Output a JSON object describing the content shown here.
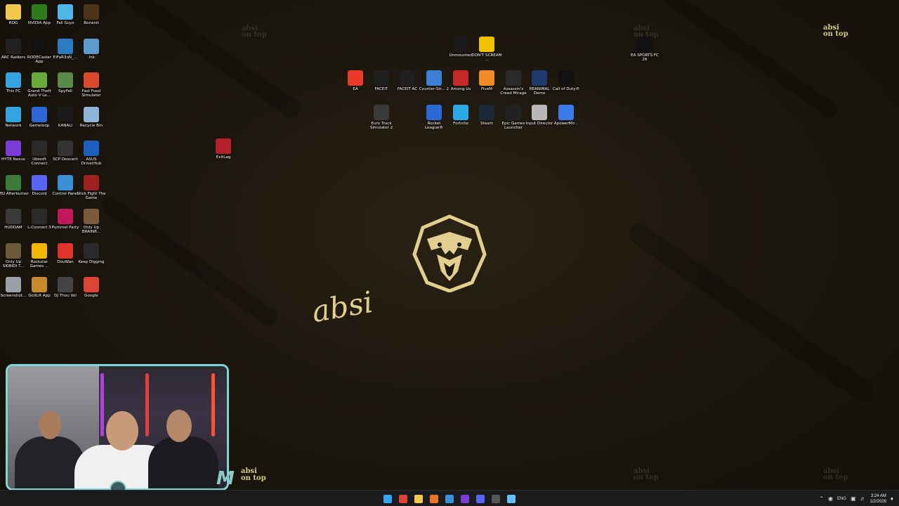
{
  "desktop": {
    "watermark_top": [
      "absi",
      "on top"
    ],
    "watermark_bottom": [
      "absi",
      "on top"
    ],
    "script_name": "absi",
    "icons_left": [
      {
        "label": "ROG",
        "icon": "folder-icon",
        "color": "#f2c94c"
      },
      {
        "label": "NVIDIA App",
        "icon": "nvidia-icon",
        "color": "#2f7a1a"
      },
      {
        "label": "Fall Guys",
        "icon": "fall-guys-icon",
        "color": "#4fb6e8"
      },
      {
        "label": "Bonanit",
        "icon": "bonanit-icon",
        "color": "#4a3318"
      },
      {
        "label": "ARC Raiders",
        "icon": "arc-raiders-icon",
        "color": "#202020"
      },
      {
        "label": "RODECaster App",
        "icon": "rodecaster-icon",
        "color": "#111111"
      },
      {
        "label": "ElFaR3oN_...",
        "icon": "file-icon",
        "color": "#2a7bbf"
      },
      {
        "label": ".lnk",
        "icon": "shortcut-icon",
        "color": "#5d9bcf"
      },
      {
        "label": "This PC",
        "icon": "this-pc-icon",
        "color": "#34a3e0"
      },
      {
        "label": "Grand Theft Auto V Le...",
        "icon": "gta-icon",
        "color": "#6aaa3a"
      },
      {
        "label": "SpyFall",
        "icon": "spyfall-icon",
        "color": "#5a8a4a"
      },
      {
        "label": "Fast Food Simulator",
        "icon": "fast-food-icon",
        "color": "#d9482a"
      },
      {
        "label": "Network",
        "icon": "network-icon",
        "color": "#34a3e0"
      },
      {
        "label": "Gameloop",
        "icon": "gameloop-icon",
        "color": "#2f66d6"
      },
      {
        "label": "KANALI",
        "icon": "kanali-icon",
        "color": "#1a1a1a"
      },
      {
        "label": "Recycle Bin",
        "icon": "recycle-bin-icon",
        "color": "#8fb6d8"
      },
      {
        "label": "HYTE Nexus",
        "icon": "hyte-icon",
        "color": "#7a3cd6"
      },
      {
        "label": "Ubisoft Connect",
        "icon": "ubisoft-icon",
        "color": "#2b2b2b"
      },
      {
        "label": "SCP Descent",
        "icon": "scp-icon",
        "color": "#333333"
      },
      {
        "label": "ASUS DriverHub",
        "icon": "asus-icon",
        "color": "#1d5fbf"
      },
      {
        "label": "MSI Afterburner",
        "icon": "msi-icon",
        "color": "#3a7a3a"
      },
      {
        "label": "Discord",
        "icon": "discord-icon",
        "color": "#5865f2"
      },
      {
        "label": "Control Panel",
        "icon": "control-panel-icon",
        "color": "#3a8fd6"
      },
      {
        "label": "Stick Fight The Game",
        "icon": "stick-fight-icon",
        "color": "#a02020"
      },
      {
        "label": "HUDDAM",
        "icon": "huddam-icon",
        "color": "#3a3a3a"
      },
      {
        "label": "L-Connect 3",
        "icon": "lconnect-icon",
        "color": "#2a2a2a"
      },
      {
        "label": "Pummel Party",
        "icon": "pummel-party-icon",
        "color": "#c2185b"
      },
      {
        "label": "Only Up BRAINR...",
        "icon": "only-up-icon",
        "color": "#7a5a3a"
      },
      {
        "label": "Only Up SKIBIDI T...",
        "icon": "only-up-skibidi-icon",
        "color": "#6a5a3a"
      },
      {
        "label": "Rockstar Games ...",
        "icon": "rockstar-icon",
        "color": "#f2b705"
      },
      {
        "label": "DouWan",
        "icon": "douwan-icon",
        "color": "#e0342a"
      },
      {
        "label": "Keep Digging",
        "icon": "keep-digging-icon",
        "color": "#2a2a2a"
      },
      {
        "label": "Screenshot...",
        "icon": "screenshot-icon",
        "color": "#9aa0a6"
      },
      {
        "label": "GoXLR App",
        "icon": "goxlr-icon",
        "color": "#c78a2a"
      },
      {
        "label": "DJ Thou Vol",
        "icon": "dj-icon",
        "color": "#444444"
      },
      {
        "label": "Google",
        "icon": "chrome-icon",
        "color": "#db4437"
      }
    ],
    "icon_exitlag": {
      "label": "ExitLag",
      "icon": "exitlag-icon",
      "color": "#b3202a"
    },
    "icons_center_row0": [
      {
        "label": "Unmounted",
        "icon": "unmounted-icon",
        "color": "#1a1a1a"
      },
      {
        "label": "DON'T SCREAM ...",
        "icon": "dont-scream-icon",
        "color": "#f2c200"
      }
    ],
    "icons_center_row1": [
      {
        "label": "EA",
        "icon": "ea-icon",
        "color": "#ea3a2a"
      },
      {
        "label": "FACEIT",
        "icon": "faceit-icon",
        "color": "#1f1f1f"
      },
      {
        "label": "FACEIT AC",
        "icon": "faceit-ac-icon",
        "color": "#1f1f1f"
      },
      {
        "label": "Counter-Str... 2",
        "icon": "cs2-icon",
        "color": "#3b7fd6"
      },
      {
        "label": "Among Us",
        "icon": "among-us-icon",
        "color": "#c62828"
      },
      {
        "label": "FiveM",
        "icon": "fivem-icon",
        "color": "#f28c28"
      },
      {
        "label": "Assassin's Creed Mirage",
        "icon": "ac-mirage-icon",
        "color": "#2a2a2a"
      },
      {
        "label": "REANIMAL Demo",
        "icon": "reanimal-icon",
        "color": "#1f3a6a"
      },
      {
        "label": "Call of Duty®",
        "icon": "cod-icon",
        "color": "#111111"
      }
    ],
    "icons_center_row2": [
      {
        "label": "Euro Truck Simulator 2",
        "icon": "ets2-icon",
        "color": "#3a3a3a"
      },
      {
        "label": "Rocket League®",
        "icon": "rocket-league-icon",
        "color": "#2a6ad6"
      },
      {
        "label": "Fortnite",
        "icon": "fortnite-icon",
        "color": "#2aa8e8"
      },
      {
        "label": "Steam",
        "icon": "steam-icon",
        "color": "#1b2838"
      },
      {
        "label": "Epic Games Launcher",
        "icon": "epic-icon",
        "color": "#222222"
      },
      {
        "label": "Input Director",
        "icon": "input-director-icon",
        "color": "#b8b8b8"
      },
      {
        "label": "ApowerMir...",
        "icon": "apowermirror-icon",
        "color": "#3a7ae8"
      }
    ],
    "icon_fc26": {
      "label": "EA SPORTS FC 26",
      "icon": "ea-fc26-icon",
      "color": "#111111"
    }
  },
  "webcam": {
    "overlay_brand": [
      "absi",
      "on top"
    ]
  },
  "taskbar": {
    "apps": [
      {
        "name": "start-button",
        "icon": "windows-icon",
        "color": "#3aa0f0"
      },
      {
        "name": "chrome",
        "icon": "chrome-icon",
        "color": "#db4437"
      },
      {
        "name": "file-explorer",
        "icon": "folder-icon",
        "color": "#f2c94c"
      },
      {
        "name": "app-orange",
        "icon": "app-icon",
        "color": "#e8742a"
      },
      {
        "name": "app-blue",
        "icon": "app-icon",
        "color": "#3a8fd6"
      },
      {
        "name": "hyte-nexus",
        "icon": "hyte-icon",
        "color": "#7a3cd6"
      },
      {
        "name": "discord",
        "icon": "discord-icon",
        "color": "#5865f2"
      },
      {
        "name": "app-dark",
        "icon": "app-icon",
        "color": "#555555"
      },
      {
        "name": "steam",
        "icon": "steam-icon",
        "color": "#66c0f4"
      }
    ],
    "tray": {
      "language": "ENG",
      "time": "3:24 AM",
      "date": "1/2/2026"
    }
  }
}
